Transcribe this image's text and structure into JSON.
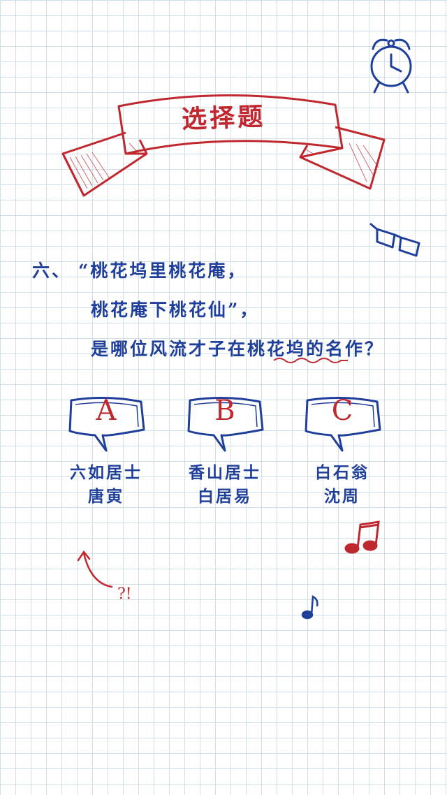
{
  "header": {
    "title": "选择题"
  },
  "question": {
    "number": "六、",
    "line1": "“桃花坞里桃花庵，",
    "line2": "桃花庵下桃花仙”，",
    "line3_prefix": "是哪位风流才子在",
    "line3_emph": "桃花坞",
    "line3_suffix": "的名作？"
  },
  "options": [
    {
      "letter": "A",
      "line1": "六如居士",
      "line2": "唐寅"
    },
    {
      "letter": "B",
      "line1": "香山居士",
      "line2": "白居易"
    },
    {
      "letter": "C",
      "line1": "白石翁",
      "line2": "沈周"
    }
  ],
  "annotations": {
    "mark": "?!"
  },
  "icons": [
    "alarm-clock-icon",
    "glasses-icon",
    "music-note-icon",
    "music-note-icon",
    "arrow-icon"
  ],
  "colors": {
    "blue": "#1f3f9a",
    "red": "#c0282f",
    "grid": "#cfe0ea"
  }
}
